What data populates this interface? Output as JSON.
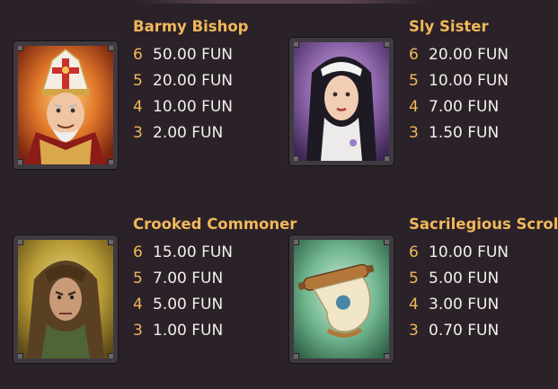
{
  "symbols": [
    {
      "id": "bishop",
      "name": "Barmy Bishop",
      "paytable": [
        {
          "count": "6",
          "value": "50.00 FUN"
        },
        {
          "count": "5",
          "value": "20.00 FUN"
        },
        {
          "count": "4",
          "value": "10.00 FUN"
        },
        {
          "count": "3",
          "value": "2.00 FUN"
        }
      ],
      "background_color": "#c2471c"
    },
    {
      "id": "sister",
      "name": "Sly Sister",
      "paytable": [
        {
          "count": "6",
          "value": "20.00 FUN"
        },
        {
          "count": "5",
          "value": "10.00 FUN"
        },
        {
          "count": "4",
          "value": "7.00 FUN"
        },
        {
          "count": "3",
          "value": "1.50 FUN"
        }
      ],
      "background_color": "#8a63a8"
    },
    {
      "id": "commoner",
      "name": "Crooked Commoner",
      "paytable": [
        {
          "count": "6",
          "value": "15.00 FUN"
        },
        {
          "count": "5",
          "value": "7.00 FUN"
        },
        {
          "count": "4",
          "value": "5.00 FUN"
        },
        {
          "count": "3",
          "value": "1.00 FUN"
        }
      ],
      "background_color": "#b79a35"
    },
    {
      "id": "scroll",
      "name": "Sacrilegious Scroll",
      "paytable": [
        {
          "count": "6",
          "value": "10.00 FUN"
        },
        {
          "count": "5",
          "value": "5.00 FUN"
        },
        {
          "count": "4",
          "value": "3.00 FUN"
        },
        {
          "count": "3",
          "value": "0.70 FUN"
        }
      ],
      "background_color": "#6fb58d"
    }
  ],
  "colors": {
    "background": "#2b2128",
    "symbol_name": "#f0b85a",
    "pay_count": "#f0b85a",
    "pay_value": "#f2f0ec",
    "frame": "#3e3a40"
  },
  "icons": [
    "bishop-portrait-icon",
    "nun-portrait-icon",
    "hooded-man-portrait-icon",
    "scroll-icon"
  ]
}
